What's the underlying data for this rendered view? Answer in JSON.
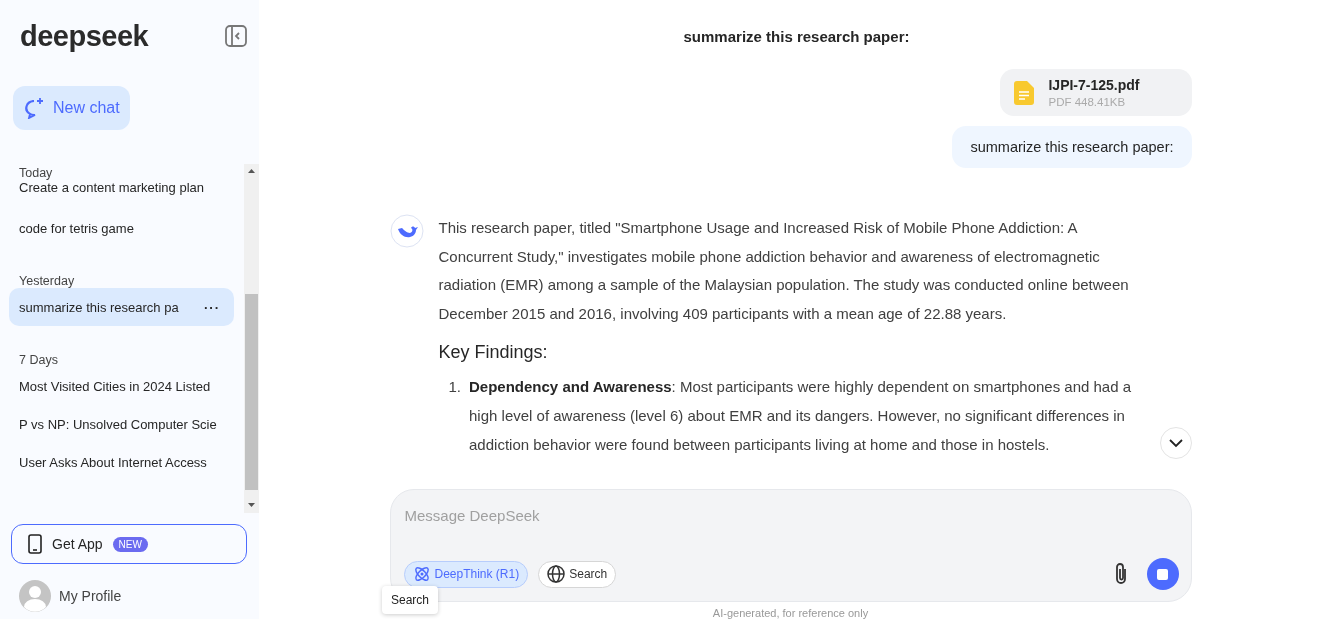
{
  "sidebar": {
    "logo": "deepseek",
    "new_chat": "New chat",
    "groups": [
      {
        "label": "Today",
        "items": [
          {
            "title": "Create a content marketing plan",
            "selected": false
          },
          {
            "title": "code for tetris game",
            "selected": false
          }
        ]
      },
      {
        "label": "Yesterday",
        "items": [
          {
            "title": "summarize this research pa",
            "selected": true
          }
        ]
      },
      {
        "label": "7 Days",
        "items": [
          {
            "title": "Most Visited Cities in 2024 Listed",
            "selected": false
          },
          {
            "title": "P vs NP: Unsolved Computer Scie",
            "selected": false
          },
          {
            "title": "User Asks About Internet Access",
            "selected": false
          }
        ]
      }
    ],
    "more": "···",
    "get_app": "Get App",
    "badge": "NEW",
    "profile": "My Profile"
  },
  "chat": {
    "title": "summarize this research paper:",
    "file": {
      "name": "IJPI-7-125.pdf",
      "meta": "PDF 448.41KB"
    },
    "user_message": "summarize this research paper:",
    "answer": {
      "intro": "This research paper, titled \"Smartphone Usage and Increased Risk of Mobile Phone Addiction: A Concurrent Study,\" investigates mobile phone addiction behavior and awareness of electromagnetic radiation (EMR) among a sample of the Malaysian population. The study was conducted online between December 2015 and 2016, involving 409 participants with a mean age of 22.88 years.",
      "heading": "Key Findings:",
      "list": [
        {
          "number": "1.",
          "text": "**Dependency and Awareness**: Most participants were highly dependent on smartphones and had a high level of awareness (level 6) about EMR and its dangers. However, no significant differences in addiction behavior were found between participants living at home and those in hostels."
        }
      ]
    }
  },
  "composer": {
    "placeholder": "Message DeepSeek",
    "toggles": [
      {
        "label": "DeepThink (R1)",
        "selected": true,
        "kind": "think"
      },
      {
        "label": "Search",
        "selected": false,
        "kind": "search"
      }
    ]
  },
  "tooltip": "Search",
  "footer": "AI-generated, for reference only"
}
